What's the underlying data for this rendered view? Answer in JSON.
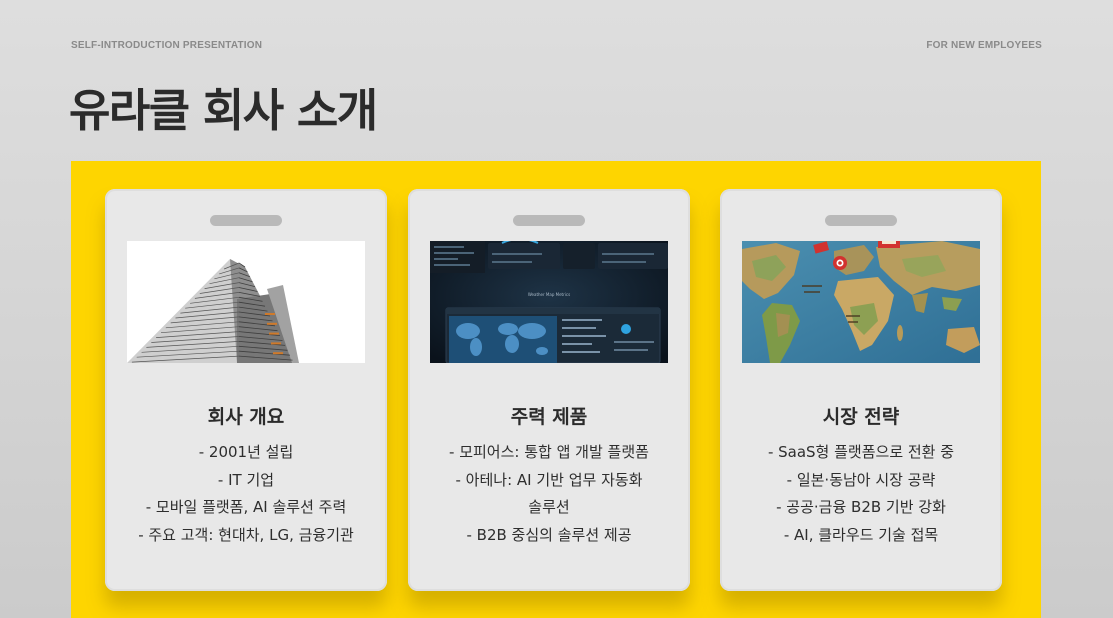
{
  "header": {
    "left_label": "SELF-INTRODUCTION PRESENTATION",
    "right_label": "FOR NEW EMPLOYEES"
  },
  "title": "유라클 회사 소개",
  "colors": {
    "background": "#d6d6d6",
    "panel": "#fed500",
    "card": "#e8e8e8",
    "text": "#2b2b2b"
  },
  "cards": [
    {
      "image": "office-building-image",
      "title": "회사 개요",
      "lines": [
        "- 2001년 설립",
        "- IT 기업",
        "- 모바일 플랫폼, AI 솔루션 주력",
        "- 주요 고객: 현대차, LG, 금융기관"
      ]
    },
    {
      "image": "dashboard-screenshot-image",
      "title": "주력 제품",
      "image_caption": "Weather Map Metrics",
      "lines": [
        "- 모피어스: 통합 앱 개발 플랫폼",
        "- 아테나: AI 기반 업무 자동화",
        "솔루션",
        "- B2B 중심의 솔루션 제공"
      ]
    },
    {
      "image": "world-map-image",
      "title": "시장 전략",
      "lines": [
        "- SaaS형 플랫폼으로 전환 중",
        "- 일본·동남아 시장 공략",
        "- 공공·금융 B2B 기반 강화",
        "- AI, 클라우드 기술 접목"
      ]
    }
  ]
}
